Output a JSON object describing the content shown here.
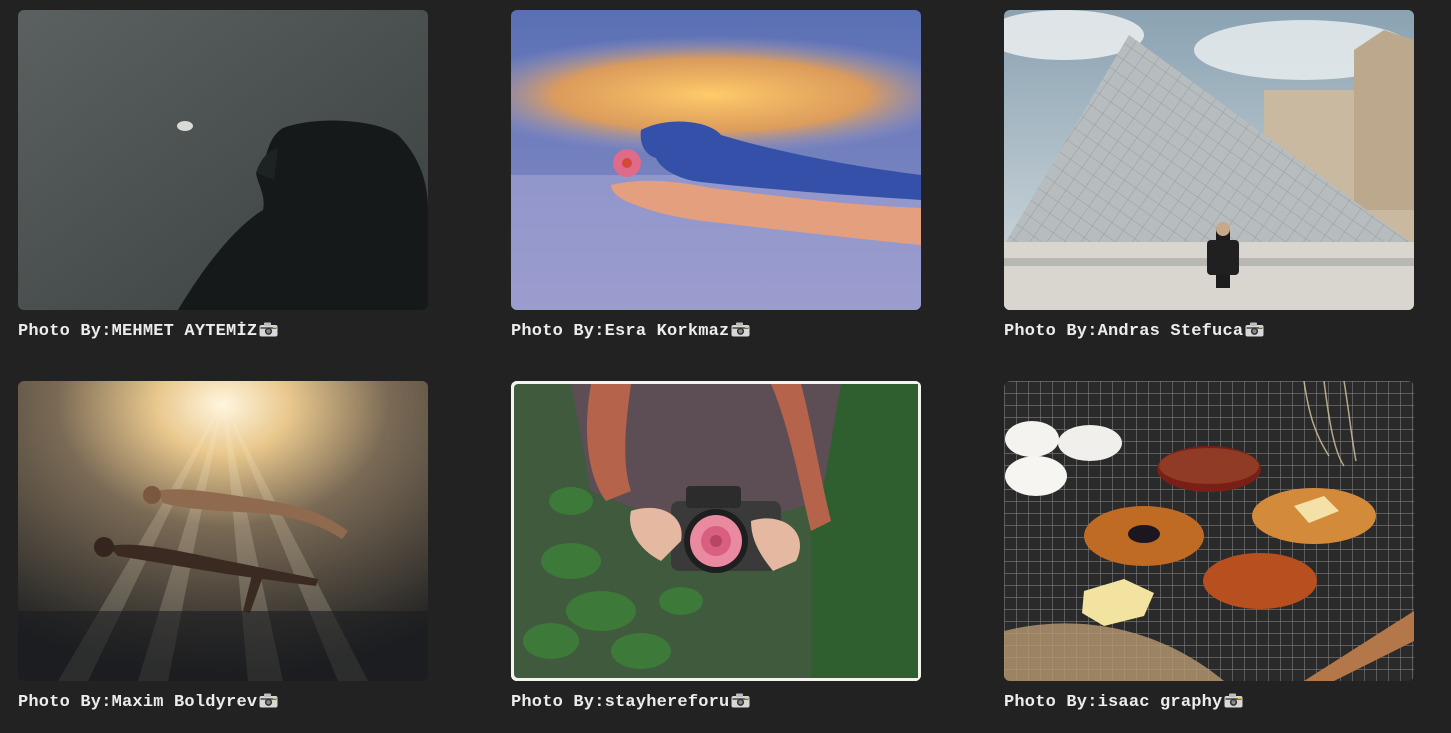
{
  "gallery": {
    "credit_prefix": "Photo By: ",
    "items": [
      {
        "author": "MEHMET AYTEMİZ",
        "subject": "silhouette of hooded person under moon"
      },
      {
        "author": "Esra Korkmaz",
        "subject": "shadow of hand holding flower on blue wall"
      },
      {
        "author": "Andras Stefuca",
        "subject": "man walking by glass pyramid"
      },
      {
        "author": "Maxim Boldyrev",
        "subject": "two swimmers underwater in sunlight"
      },
      {
        "author": "stayhereforu",
        "subject": "person holding camera with rose"
      },
      {
        "author": "isaac graphy",
        "subject": "pastries and eggs on cooling rack"
      }
    ],
    "icon": "camera-icon"
  }
}
